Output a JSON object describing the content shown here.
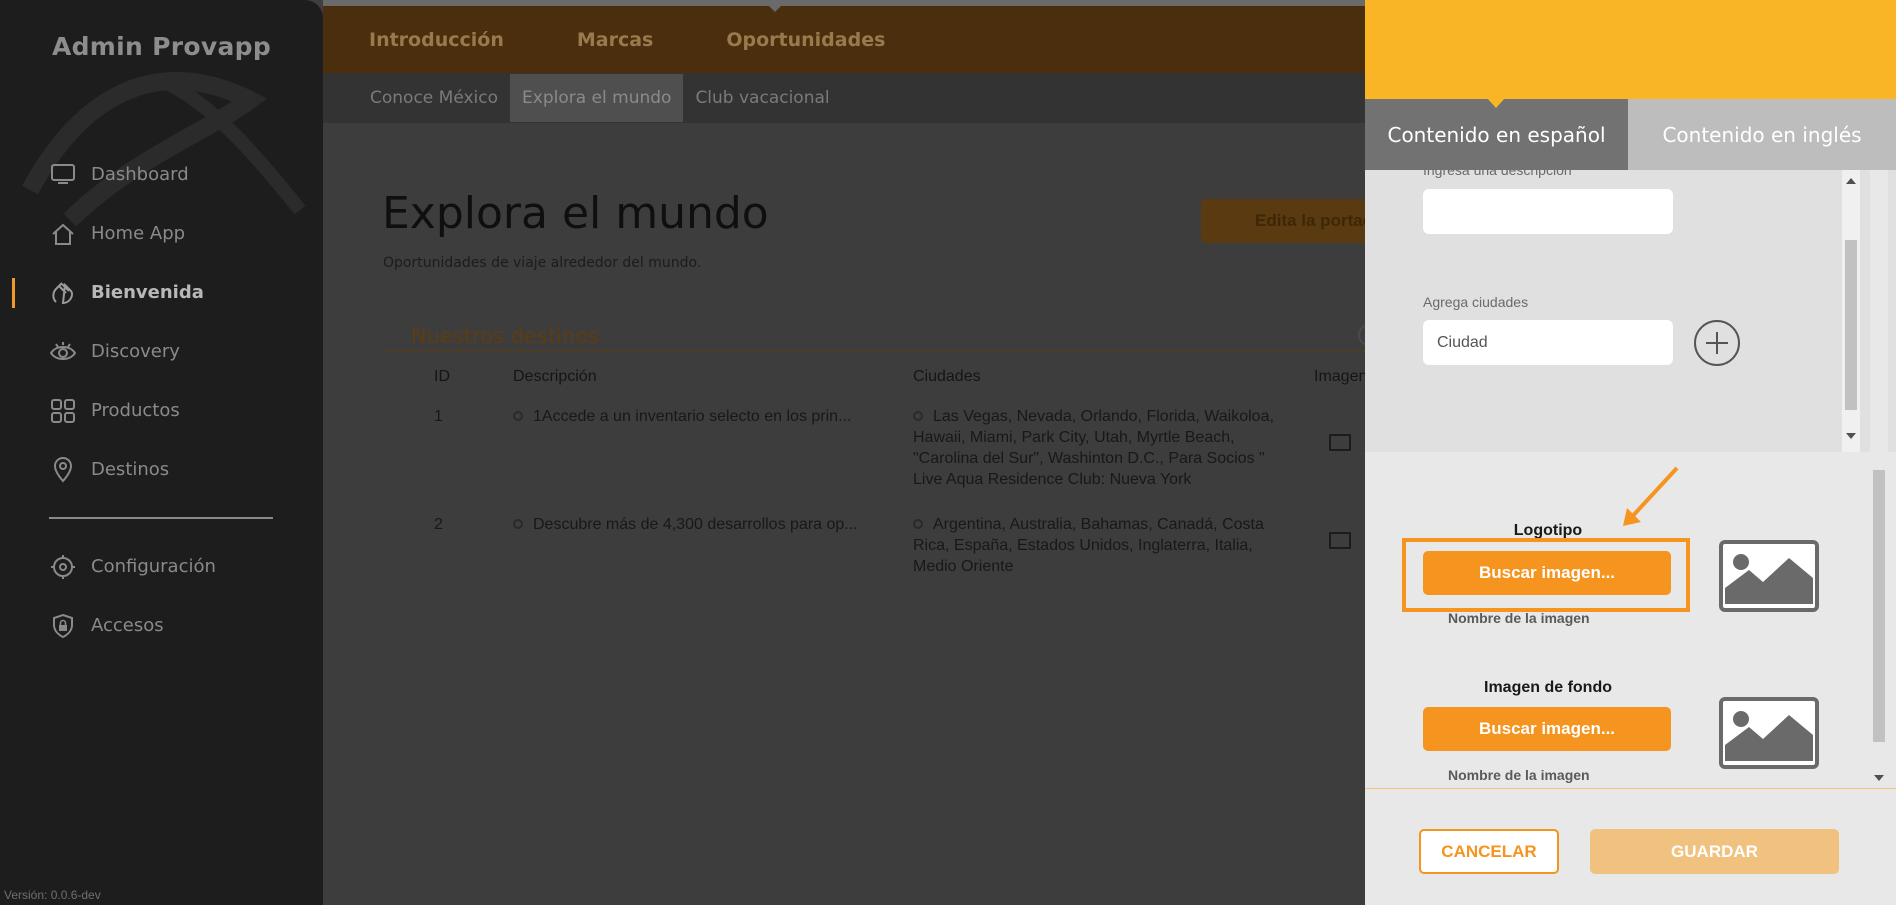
{
  "sidebar": {
    "brand": "Admin Provapp",
    "items": [
      {
        "label": "Dashboard",
        "icon": "monitor-icon"
      },
      {
        "label": "Home App",
        "icon": "home-icon"
      },
      {
        "label": "Bienvenida",
        "icon": "waving-hand-icon",
        "active": true
      },
      {
        "label": "Discovery",
        "icon": "eye-icon"
      },
      {
        "label": "Productos",
        "icon": "grid-icon"
      },
      {
        "label": "Destinos",
        "icon": "map-pin-icon"
      }
    ],
    "items2": [
      {
        "label": "Configuración",
        "icon": "gear-icon"
      },
      {
        "label": "Accesos",
        "icon": "shield-lock-icon"
      }
    ],
    "version": "Versión: 0.0.6-dev"
  },
  "topnav": {
    "tabs": [
      "Introducción",
      "Marcas",
      "Oportunidades"
    ],
    "subtabs": [
      "Conoce México",
      "Explora el mundo",
      "Club vacacional"
    ]
  },
  "page": {
    "title": "Explora el mundo",
    "subtitle": "Oportunidades de viaje alrededor del mundo.",
    "edit_button": "Edita la portada",
    "section_title": "Nuestros destinos",
    "table": {
      "headers": [
        "ID",
        "Descripción",
        "Ciudades",
        "Imagen"
      ],
      "rows": [
        {
          "id": "1",
          "description": "1Accede a un inventario selecto en los prin...",
          "cities": "Las Vegas, Nevada, Orlando, Florida, Waikoloa, Hawaii, Miami, Park City, Utah, Myrtle Beach, \"Carolina del Sur\", Washinton D.C., Para Socios \" Live Aqua Residence Club: Nueva York",
          "cities_lines": [
            "Las Vegas, Nevada, Orlando, Florida, Waikoloa,",
            "Hawaii, Miami, Park City, Utah, Myrtle Beach,",
            "\"Carolina del Sur\", Washinton D.C., Para Socios \"",
            "Live Aqua Residence Club: Nueva York"
          ]
        },
        {
          "id": "2",
          "description": "Descubre más de 4,300 desarrollos para op...",
          "cities_lines": [
            "Argentina, Australia, Bahamas, Canadá, Costa",
            "Rica, España, Estados Unidos, Inglaterra, Italia,",
            "Medio Oriente"
          ]
        }
      ]
    }
  },
  "panel": {
    "tabs": [
      "Contenido en español",
      "Contenido en inglés"
    ],
    "desc_label": "Ingresa una descripción",
    "cities_label": "Agrega ciudades",
    "city_placeholder": "Ciudad",
    "logo_label": "Logotipo",
    "logo_button": "Buscar imagen...",
    "logo_hint": "Nombre de la imagen",
    "bg_label": "Imagen de fondo",
    "bg_button": "Buscar imagen...",
    "bg_hint": "Nombre de la imagen",
    "cancel": "CANCELAR",
    "save": "GUARDAR"
  },
  "colors": {
    "accent": "#f5941e",
    "panel_header": "#fab527",
    "sidebar": "#1d1d1d"
  }
}
